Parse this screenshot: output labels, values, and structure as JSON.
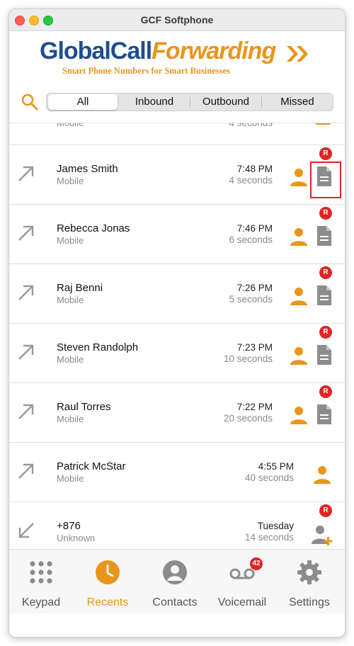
{
  "window": {
    "title": "GCF Softphone"
  },
  "logo": {
    "part1": "Global",
    "part2": "Call",
    "part3": "Forwarding",
    "tagline": "Smart Phone Numbers for Smart Businesses"
  },
  "filter": {
    "tabs": [
      {
        "label": "All",
        "active": true
      },
      {
        "label": "Inbound",
        "active": false
      },
      {
        "label": "Outbound",
        "active": false
      },
      {
        "label": "Missed",
        "active": false
      }
    ]
  },
  "calls": [
    {
      "name": "James Smith",
      "type": "Mobile",
      "time": "7:48 PM",
      "duration": "4 seconds",
      "direction": "outbound",
      "recorded": true,
      "badge": "R"
    },
    {
      "name": "Rebecca Jonas",
      "type": "Mobile",
      "time": "7:46 PM",
      "duration": "6 seconds",
      "direction": "outbound",
      "recorded": true,
      "badge": "R"
    },
    {
      "name": "Raj Benni",
      "type": "Mobile",
      "time": "7:26 PM",
      "duration": "5 seconds",
      "direction": "outbound",
      "recorded": true,
      "badge": "R"
    },
    {
      "name": "Steven Randolph",
      "type": "Mobile",
      "time": "7:23 PM",
      "duration": "10 seconds",
      "direction": "outbound",
      "recorded": true,
      "badge": "R"
    },
    {
      "name": "Raul Torres",
      "type": "Mobile",
      "time": "7:22 PM",
      "duration": "20 seconds",
      "direction": "outbound",
      "recorded": true,
      "badge": "R"
    },
    {
      "name": "Patrick McStar",
      "type": "Mobile",
      "time": "4:55 PM",
      "duration": "40 seconds",
      "direction": "outbound",
      "recorded": false
    },
    {
      "name": "+876",
      "type": "Unknown",
      "time": "Tuesday",
      "duration": "14 seconds",
      "direction": "inbound",
      "recorded": false,
      "badge": "R"
    }
  ],
  "partial_row": {
    "type": "Mobile",
    "duration": "4 seconds"
  },
  "tabs": [
    {
      "label": "Keypad",
      "icon": "keypad-icon",
      "active": false
    },
    {
      "label": "Recents",
      "icon": "clock-icon",
      "active": true
    },
    {
      "label": "Contacts",
      "icon": "contact-icon",
      "active": false
    },
    {
      "label": "Voicemail",
      "icon": "voicemail-icon",
      "active": false,
      "badge": "42"
    },
    {
      "label": "Settings",
      "icon": "gear-icon",
      "active": false
    }
  ],
  "colors": {
    "accent": "#e8961b",
    "brand_blue": "#1e4d8c",
    "badge_red": "#e02424",
    "icon_gray": "#8c8c8c"
  }
}
